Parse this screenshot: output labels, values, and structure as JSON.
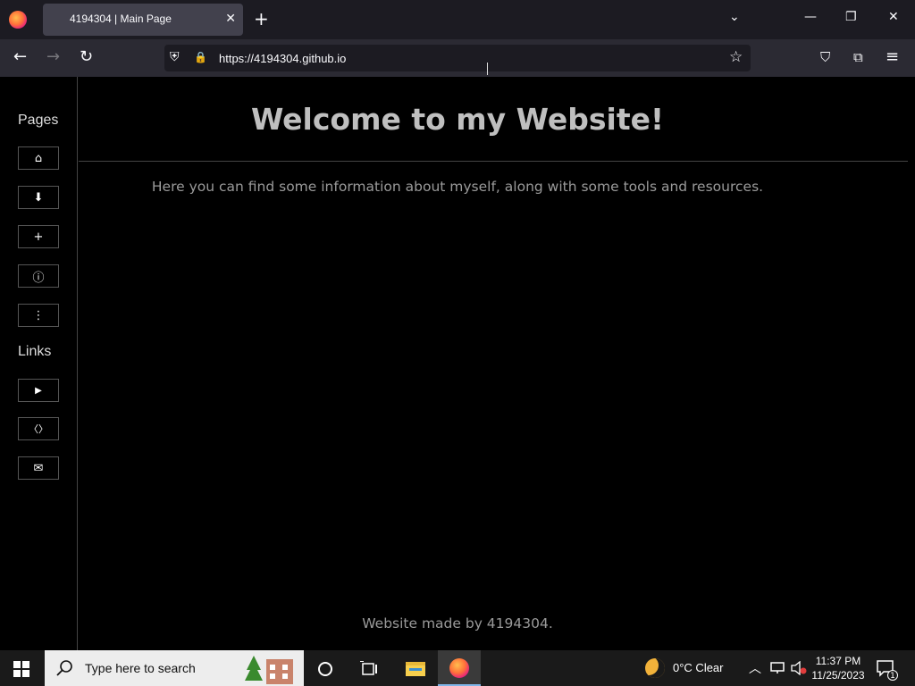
{
  "browser": {
    "tab_title": "4194304 | Main Page",
    "tab_close": "✕",
    "new_tab": "+",
    "url": "https://4194304.github.io",
    "win_min": "—",
    "win_restore": "❐",
    "win_close": "✕",
    "list_all_tabs": "⌄",
    "back": "←",
    "forward": "→",
    "reload": "↻",
    "bookmark": "☆",
    "pocket": "⛉",
    "extensions": "⧉",
    "menu": "≡",
    "shield": "⛨",
    "lock": "🔒"
  },
  "sidebar": {
    "pages_heading": "Pages",
    "links_heading": "Links",
    "pages": [
      {
        "icon": "⌂",
        "name": "home-icon"
      },
      {
        "icon": "⬇",
        "name": "download-icon"
      },
      {
        "icon": "+",
        "name": "plus-icon"
      },
      {
        "icon": "ⓘ",
        "name": "info-icon"
      },
      {
        "icon": "⋮",
        "name": "more-icon"
      }
    ],
    "links": [
      {
        "icon": "▶",
        "name": "play-icon"
      },
      {
        "icon": "〈〉",
        "name": "code-icon"
      },
      {
        "icon": "✉",
        "name": "mail-icon"
      }
    ]
  },
  "main": {
    "title": "Welcome to my Website!",
    "intro": "Here you can find some information about myself, along with some tools and resources.",
    "footer": "Website made by 4194304."
  },
  "taskbar": {
    "search_placeholder": "Type here to search",
    "weather": "0°C  Clear",
    "time": "11:37 PM",
    "date": "11/25/2023",
    "notification_count": "1"
  },
  "colors": {
    "firefox_accent": "#ff7139",
    "page_bg": "#000000"
  }
}
